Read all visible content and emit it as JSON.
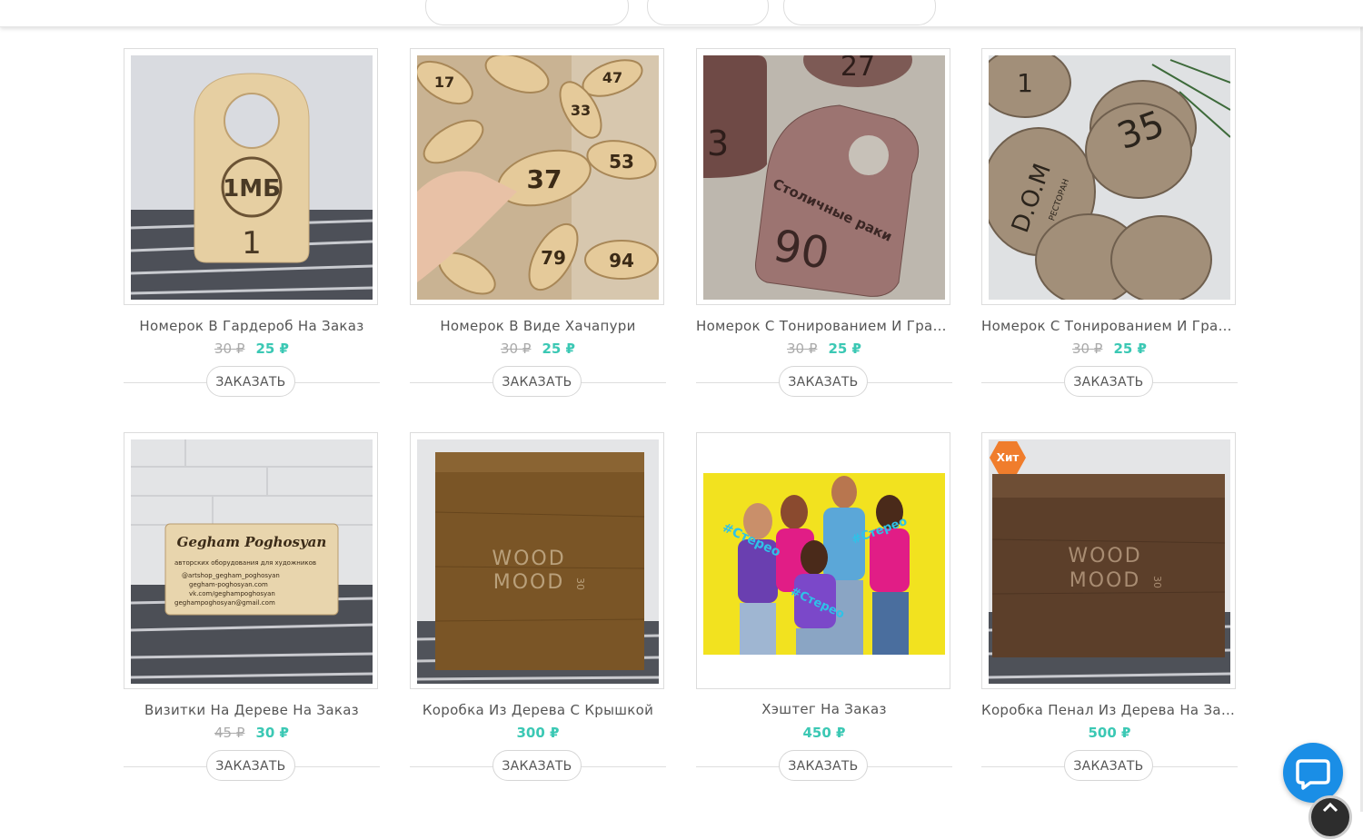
{
  "currency": "₽",
  "order_label": "ЗАКАЗАТЬ",
  "products": [
    {
      "title": "Номерок В Гардероб На Заказ",
      "old_price": "30",
      "price": "25"
    },
    {
      "title": "Номерок В Виде Хачапури",
      "old_price": "30",
      "price": "25"
    },
    {
      "title": "Номерок С Тонированием И Грави...",
      "old_price": "30",
      "price": "25"
    },
    {
      "title": "Номерок С Тонированием И Грави...",
      "old_price": "30",
      "price": "25"
    },
    {
      "title": "Визитки На Дереве На Заказ",
      "old_price": "45",
      "price": "30"
    },
    {
      "title": "Коробка Из Дерева С Крышкой",
      "old_price": null,
      "price": "300"
    },
    {
      "title": "Хэштег На Заказ",
      "old_price": null,
      "price": "450"
    },
    {
      "title": "Коробка Пенал Из Дерева На Заказ",
      "old_price": null,
      "price": "500",
      "badge": "Хит"
    }
  ],
  "images": {
    "tag1": {
      "logo": "1МБ",
      "number": "1"
    },
    "leaf": {
      "numbers": [
        "37",
        "53",
        "79",
        "94",
        "33",
        "47",
        "17"
      ]
    },
    "pink": {
      "number": "90",
      "brand": "Столичные раки",
      "top_number": "27"
    },
    "dom": {
      "number": "35",
      "brand": "D.O.M",
      "sub": "РЕСТОРАН"
    },
    "card": {
      "name": "Gegham Poghosyan",
      "line1": "авторских оборудования для художников",
      "line2": "@artshop_gegham_poghosyan",
      "line3": "gegham-poghosyan.com",
      "line4": "vk.com/geghampoghosyan",
      "line5": "geghampoghosyan@gmail.com"
    },
    "box": {
      "brand_top": "WOOD",
      "brand_bottom": "MOOD",
      "side": "30"
    },
    "hashtag": {
      "tag": "#Стерео"
    }
  },
  "colors": {
    "accent": "#3bc8b4",
    "badge": "#f07d2c",
    "chat": "#1a8ee6"
  }
}
